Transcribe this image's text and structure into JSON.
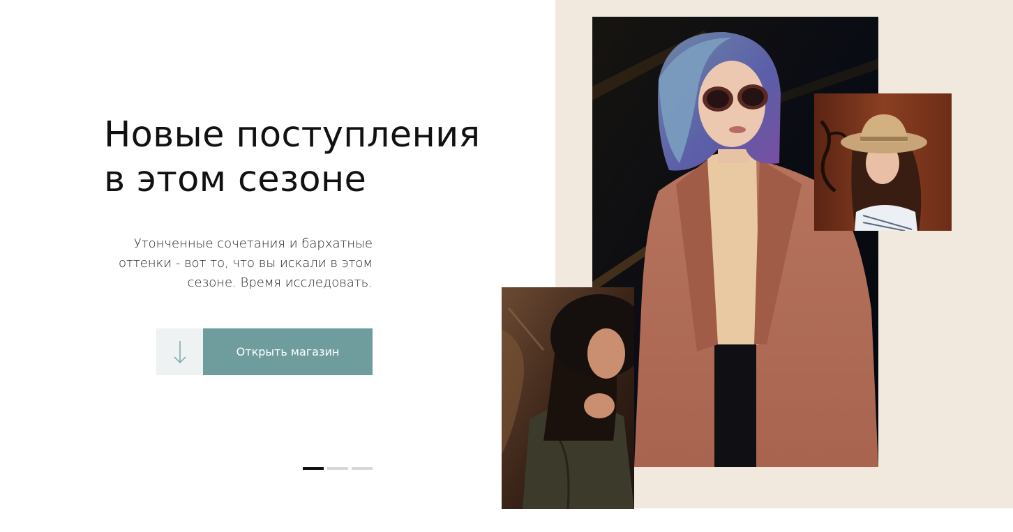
{
  "hero": {
    "title_line1": "Новые поступления",
    "title_line2": "в этом сезоне",
    "text_line1": "Утонченные сочетания и бархатные",
    "text_line2": "оттенки - вот то, что вы искали в этом",
    "text_line3": "сезоне. Время исследовать.",
    "cta_label": "Открыть магазин",
    "cta_icon": "arrow-down-icon"
  },
  "slider": {
    "total": 3,
    "active": 1
  },
  "colors": {
    "accent": "#6f9d9e",
    "panel_bg": "#f1e8de",
    "arrow_bg": "#eef2f3"
  }
}
